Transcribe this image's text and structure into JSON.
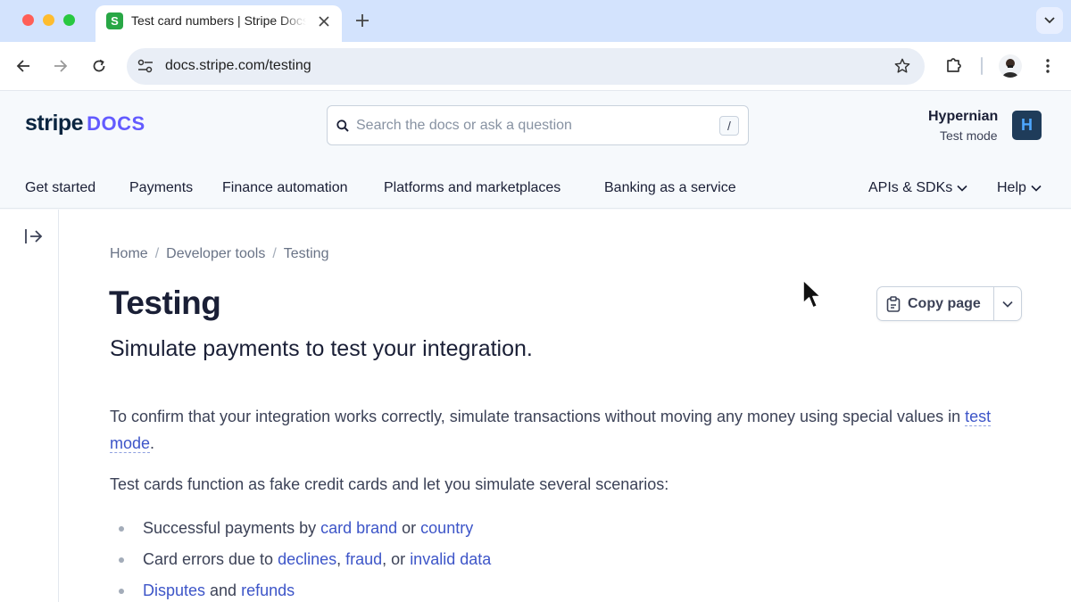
{
  "browser": {
    "tab": {
      "title": "Test card numbers | Stripe Docs",
      "favicon_letter": "S"
    },
    "new_tab_label": "+",
    "url": "docs.stripe.com/testing"
  },
  "header": {
    "logo_main": "stripe",
    "logo_docs": "DOCS",
    "search_placeholder": "Search the docs or ask a question",
    "search_shortcut": "/",
    "account": {
      "name": "Hypernian",
      "mode": "Test mode",
      "avatar_letter": "H"
    }
  },
  "topnav": {
    "items": [
      "Get started",
      "Payments",
      "Finance automation",
      "Platforms and marketplaces",
      "Banking as a service"
    ],
    "right": [
      "APIs & SDKs",
      "Help"
    ]
  },
  "content": {
    "breadcrumb": [
      "Home",
      "Developer tools",
      "Testing"
    ],
    "breadcrumb_separator": "/",
    "title": "Testing",
    "subtitle": "Simulate payments to test your integration.",
    "copy_button": "Copy page",
    "intro_before": "To confirm that your integration works correctly, simulate transactions without moving any money using special values in ",
    "intro_link": "test mode",
    "intro_after": ".",
    "cards_intro": "Test cards function as fake credit cards and let you simulate several scenarios:",
    "bullets": {
      "b1_pre": "Successful payments by ",
      "b1_link1": "card brand",
      "b1_mid": " or ",
      "b1_link2": "country",
      "b2_pre": "Card errors due to ",
      "b2_link1": "declines",
      "b2_sep1": ", ",
      "b2_link2": "fraud",
      "b2_sep2": ", or ",
      "b2_link3": "invalid data",
      "b3_link1": "Disputes",
      "b3_mid": " and ",
      "b3_link2": "refunds"
    }
  },
  "colors": {
    "brand_purple": "#635bff",
    "link": "#3d55c8",
    "tabbar": "#d3e3fd"
  },
  "icons": [
    "close-icon",
    "plus-icon",
    "chevron-down-icon",
    "back-arrow-icon",
    "forward-arrow-icon",
    "reload-icon",
    "tune-icon",
    "star-icon",
    "extensions-icon",
    "kebab-icon",
    "search-icon",
    "expand-sidebar-icon",
    "clipboard-icon",
    "mouse-cursor-icon"
  ]
}
